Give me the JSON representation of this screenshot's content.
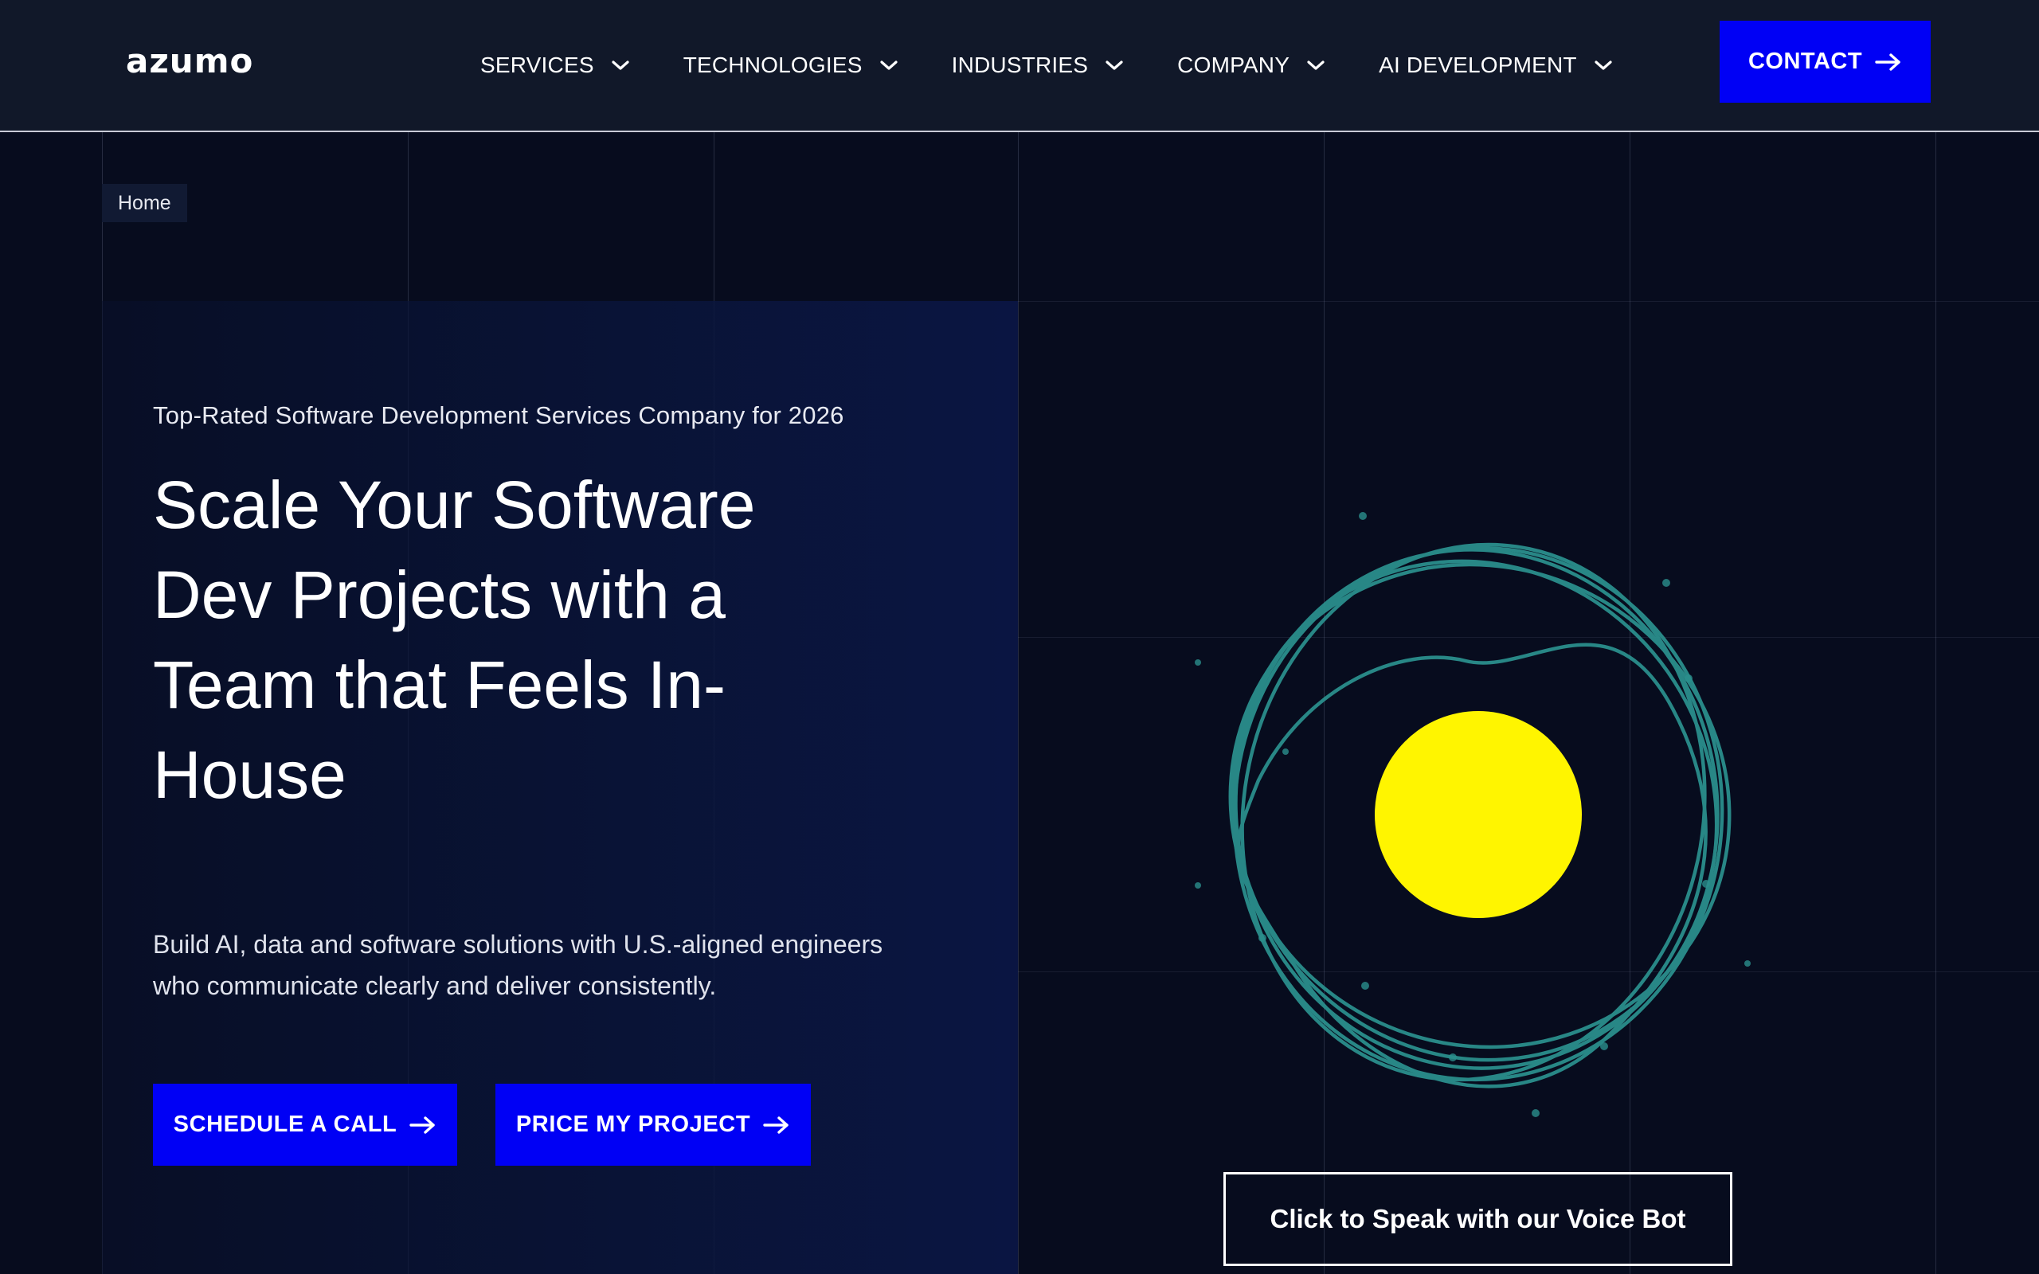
{
  "header": {
    "logo": "azumo",
    "nav": [
      {
        "label": "SERVICES",
        "name": "nav-services"
      },
      {
        "label": "TECHNOLOGIES",
        "name": "nav-technologies"
      },
      {
        "label": "INDUSTRIES",
        "name": "nav-industries"
      },
      {
        "label": "COMPANY",
        "name": "nav-company"
      },
      {
        "label": "AI DEVELOPMENT",
        "name": "nav-ai-development"
      }
    ],
    "contact_label": "CONTACT"
  },
  "breadcrumb": {
    "home": "Home"
  },
  "hero": {
    "eyebrow": "Top-Rated Software Development Services Company for 2026",
    "headline_lines": [
      "Scale Your Software",
      "Dev Projects with a",
      "Team that Feels In-",
      "House"
    ],
    "subtext_lines": [
      "Build AI, data and software solutions with U.S.-aligned engineers",
      "who communicate clearly and deliver consistently."
    ],
    "cta_schedule": "SCHEDULE A CALL",
    "cta_price": "PRICE MY PROJECT"
  },
  "voice_bot": {
    "label": "Click to Speak with our Voice Bot"
  },
  "colors": {
    "background": "#070c1e",
    "header": "#111829",
    "accent_blue": "#0000f5",
    "orb_yellow": "#fff500",
    "ring_teal": "#2a8e8c"
  },
  "icons": {
    "nav_chevron": "chevron-down-icon",
    "button_arrow": "arrow-right-icon"
  }
}
